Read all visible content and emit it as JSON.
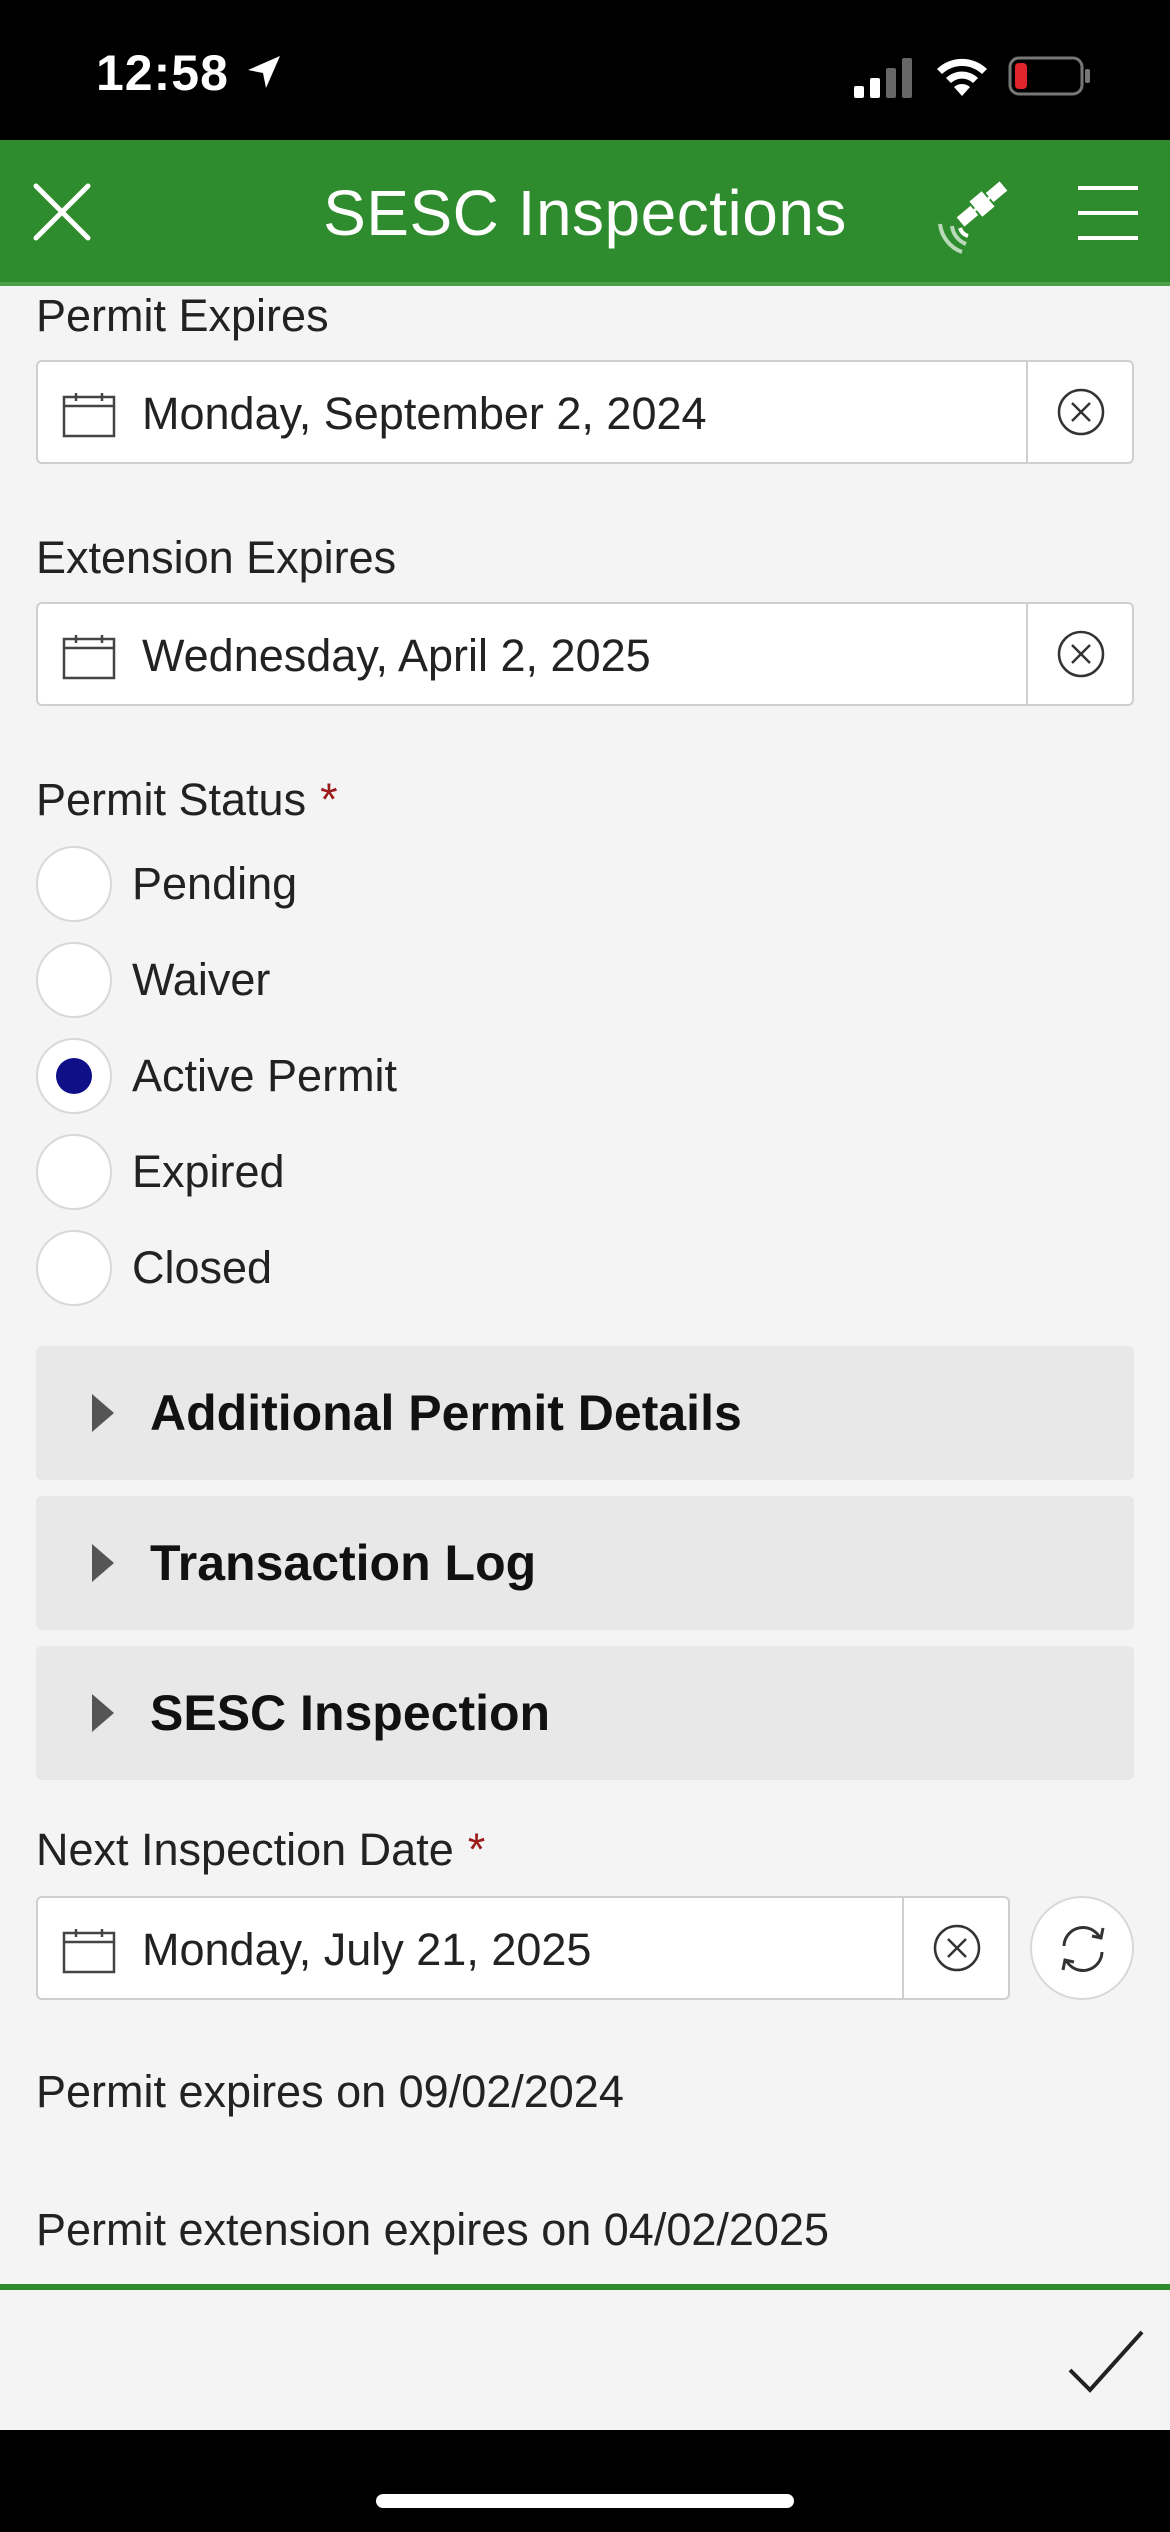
{
  "status_bar": {
    "time": "12:58",
    "icons": [
      "location-arrow-icon",
      "cellular-signal-icon",
      "wifi-icon",
      "battery-low-icon"
    ],
    "battery_color": "#e0242c"
  },
  "header": {
    "title": "SESC Inspections",
    "background": "#2f8c2e",
    "icons": [
      "close-icon",
      "gps-satellite-icon",
      "hamburger-menu-icon"
    ]
  },
  "form": {
    "permit_expires": {
      "label": "Permit Expires",
      "value": "Monday, September 2, 2024"
    },
    "extension_expires": {
      "label": "Extension Expires",
      "value": "Wednesday, April 2, 2025"
    },
    "permit_status": {
      "label": "Permit Status",
      "required_mark": "*",
      "options": [
        {
          "label": "Pending",
          "selected": false
        },
        {
          "label": "Waiver",
          "selected": false
        },
        {
          "label": "Active Permit",
          "selected": true
        },
        {
          "label": "Expired",
          "selected": false
        },
        {
          "label": "Closed",
          "selected": false
        }
      ],
      "selected_color": "#0f0f87"
    },
    "groups": [
      {
        "label": "Additional Permit Details"
      },
      {
        "label": "Transaction Log"
      },
      {
        "label": "SESC Inspection"
      }
    ],
    "next_inspection_date": {
      "label": "Next Inspection Date",
      "required_mark": "*",
      "value": "Monday, July 21, 2025"
    },
    "notes": [
      "Permit expires on 09/02/2024",
      "Permit extension expires on 04/02/2025"
    ]
  },
  "bottom_bar": {
    "icons": [
      "checkmark-submit-icon"
    ],
    "accent": "#2f8c2e"
  }
}
